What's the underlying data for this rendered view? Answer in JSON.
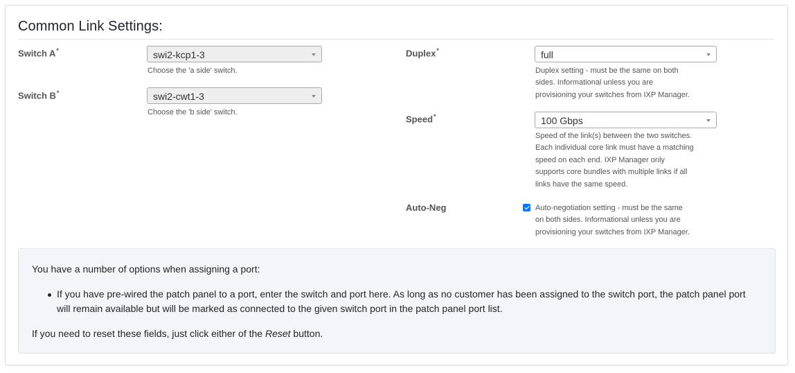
{
  "section": {
    "title": "Common Link Settings:"
  },
  "switch_a": {
    "label": "Switch A",
    "required_mark": "*",
    "value": "swi2-kcp1-3",
    "help": "Choose the 'a side' switch."
  },
  "switch_b": {
    "label": "Switch B",
    "required_mark": "*",
    "value": "swi2-cwt1-3",
    "help": "Choose the 'b side' switch."
  },
  "duplex": {
    "label": "Duplex",
    "required_mark": "*",
    "value": "full",
    "help_lines": [
      "Duplex setting - must be the same on both",
      "sides. Informational unless you are",
      "provisioning your switches from IXP Manager."
    ]
  },
  "speed": {
    "label": "Speed",
    "required_mark": "*",
    "value": "100 Gbps",
    "help_lines": [
      "Speed of the link(s) between the two switches.",
      "Each individual core link must have a matching",
      "speed on each end. IXP Manager only",
      "supports core bundles with multiple links if all",
      "links have the same speed."
    ]
  },
  "auto_neg": {
    "label": "Auto-Neg",
    "checked": true,
    "help_lines": [
      "Auto-negotiation setting - must be the same",
      "on both sides. Informational unless you are",
      "provisioning your switches from IXP Manager."
    ]
  },
  "info": {
    "intro": "You have a number of options when assigning a port:",
    "bullet": "If you have pre-wired the patch panel to a port, enter the switch and port here. As long as no customer has been assigned to the switch port, the patch panel port will remain available but will be marked as connected to the given switch port in the patch panel port list.",
    "reset_prefix": "If you need to reset these fields, just click either of the ",
    "reset_emphasis": "Reset",
    "reset_suffix": " button."
  }
}
